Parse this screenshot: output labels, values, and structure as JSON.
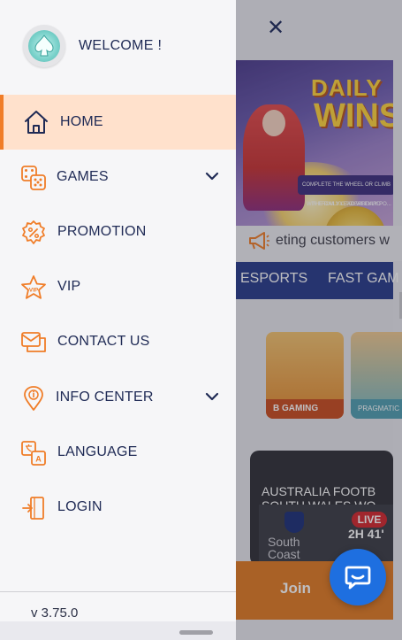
{
  "drawer": {
    "welcome": "WELCOME !",
    "version": "v 3.75.0",
    "items": [
      {
        "label": "HOME",
        "icon": "home-icon",
        "active": true
      },
      {
        "label": "GAMES",
        "icon": "dice-icon",
        "has_submenu": true
      },
      {
        "label": "PROMOTION",
        "icon": "percent-badge-icon"
      },
      {
        "label": "VIP",
        "icon": "vip-star-icon"
      },
      {
        "label": "CONTACT US",
        "icon": "chat-envelope-icon"
      },
      {
        "label": "INFO CENTER",
        "icon": "info-pin-icon",
        "has_submenu": true
      },
      {
        "label": "LANGUAGE",
        "icon": "translate-icon"
      },
      {
        "label": "LOGIN",
        "icon": "login-door-icon"
      }
    ]
  },
  "background": {
    "close_symbol": "✕",
    "banner": {
      "title_line1": "DAILY",
      "title_line2": "WINS",
      "ribbon": "COMPLETE THE WHEEL OR CLIMB THE DAILY LEADERBOARD",
      "subline": "WIN FROM 100,000 WEEKLY PO..."
    },
    "marquee": "eting customers w",
    "tabs": [
      "ESPORTS",
      "FAST GAM"
    ],
    "games": [
      {
        "label": "B GAMING"
      },
      {
        "label": "PRAGMATIC"
      }
    ],
    "match": {
      "header_line1": "AUSTRALIA FOOTB",
      "header_line2": "SOUTH WALES WO",
      "team_line1": "South",
      "team_line2": "Coast",
      "status": "LIVE",
      "clock": "2H 41'"
    },
    "join_label": "Join"
  },
  "colors": {
    "accent": "#f07d28",
    "accent_light": "#ffe1cc",
    "nav_text": "#1f2a55",
    "tab_bar": "#263a8a",
    "chat_button": "#1e6fe0"
  }
}
